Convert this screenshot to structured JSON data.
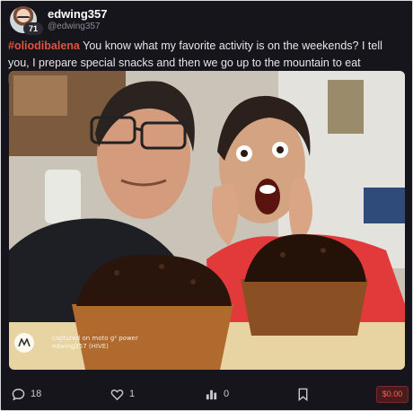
{
  "author": {
    "display_name": "edwing357",
    "handle": "@edwing357",
    "reputation": "71"
  },
  "post": {
    "hashtag": "#oliodibalena",
    "body": " You know what my favorite activity is on the weekends? I tell you, I prepare special snacks and then we go up to the mountain to eat hahaha."
  },
  "photo_watermark": {
    "line1": "captured on moto g² power",
    "line2": "edwing357 (HIVE)"
  },
  "actions": {
    "comments_count": "18",
    "likes_count": "1",
    "views_count": "0",
    "payout": "$0.00"
  },
  "icons": {
    "comment": "comment-icon",
    "like": "heart-icon",
    "views": "bar-chart-icon",
    "bookmark": "bookmark-icon"
  },
  "colors": {
    "card_bg": "#16151b",
    "hashtag": "#e0533f",
    "payout_text": "#ff5c5c",
    "payout_bg": "#4a1b1b"
  }
}
